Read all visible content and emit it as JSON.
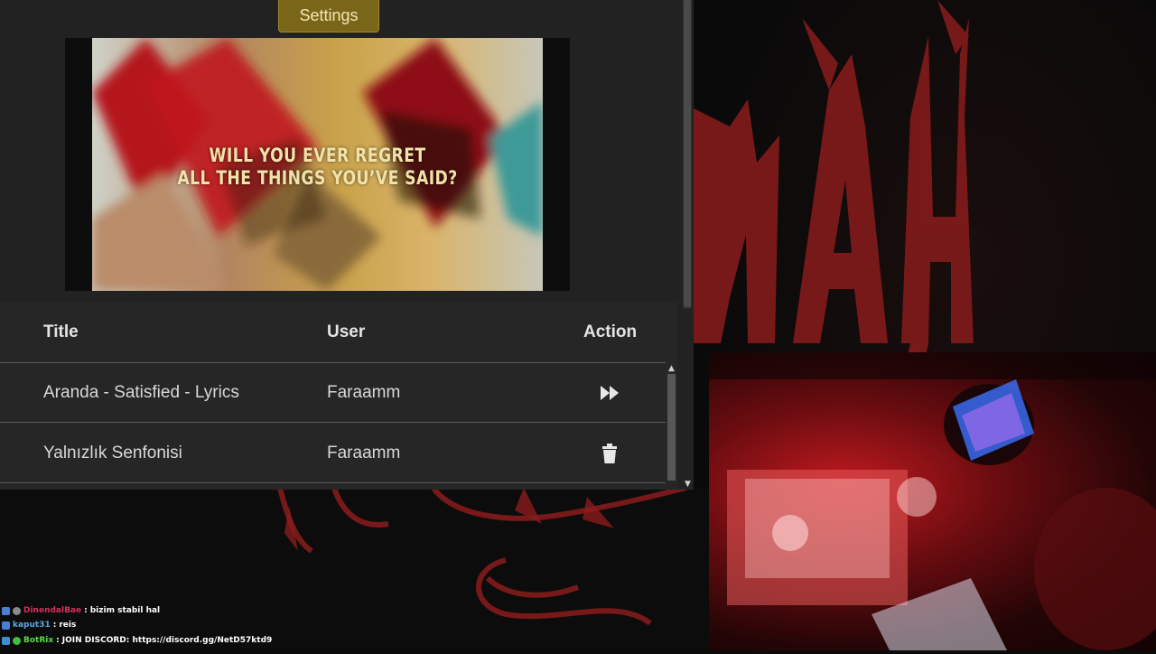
{
  "settings_label": "Settings",
  "video": {
    "lyric_line_1": "WILL YOU EVER REGRET",
    "lyric_line_2": "ALL THE THINGS YOU’VE SAID?"
  },
  "queue": {
    "columns": {
      "title": "Title",
      "user": "User",
      "action": "Action"
    },
    "rows": [
      {
        "title": "Aranda - Satisfied - Lyrics",
        "user": "Faraamm",
        "action_icon": "fast-forward-icon"
      },
      {
        "title": "Yalnızlık Senfonisi",
        "user": "Faraamm",
        "action_icon": "trash-icon"
      }
    ]
  },
  "chat": [
    {
      "user": "DinendalBae",
      "message": "bizim stabil hal",
      "name_color": "#d6305a"
    },
    {
      "user": "kaput31",
      "message": "reis",
      "name_color": "#5aa6e0"
    },
    {
      "user": "BotRix",
      "message": "JOIN DISCORD: https://discord.gg/NetD57ktd9",
      "name_color": "#59d84a"
    }
  ],
  "colors": {
    "panel_bg": "#222222",
    "settings_button": "#7a6618",
    "art_red": "#8a1c1c"
  }
}
